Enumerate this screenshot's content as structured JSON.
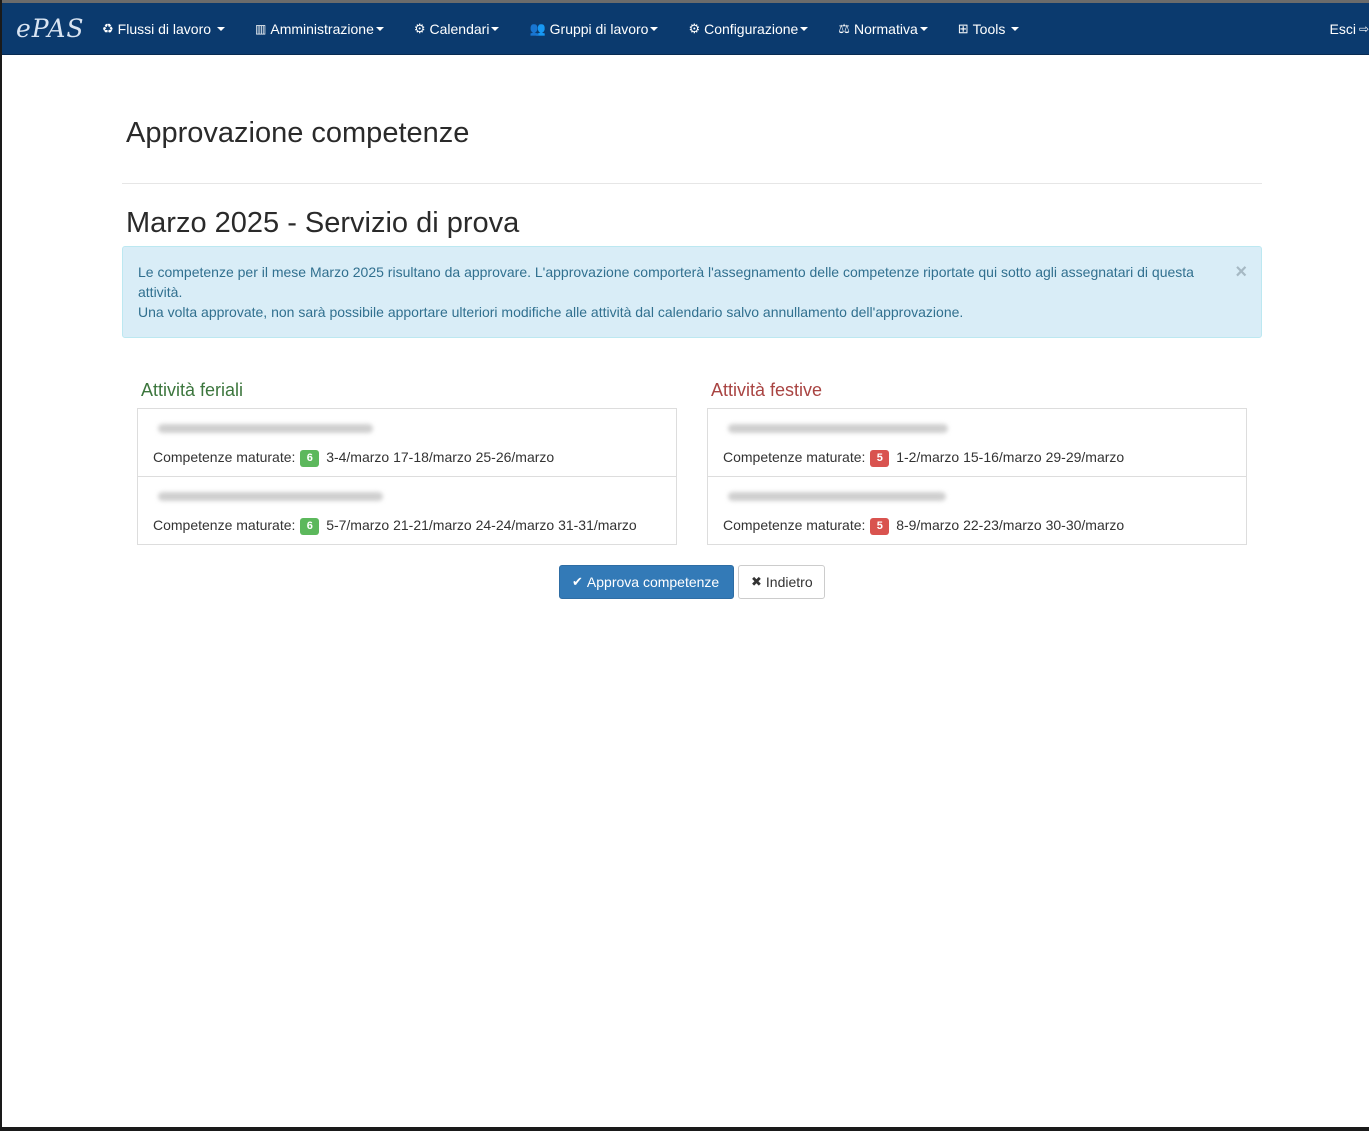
{
  "app": {
    "brand": "ePAS"
  },
  "nav": {
    "items": [
      {
        "label": "Flussi di lavoro",
        "icon": "recycle-icon",
        "glyph": "♻"
      },
      {
        "label": "Amministrazione",
        "icon": "bar-chart-icon",
        "glyph": "📊"
      },
      {
        "label": "Calendari",
        "icon": "gear-icon",
        "glyph": "⚙"
      },
      {
        "label": "Gruppi di lavoro",
        "icon": "users-icon",
        "glyph": "👥"
      },
      {
        "label": "Configurazione",
        "icon": "gear-icon",
        "glyph": "⚙"
      },
      {
        "label": "Normativa",
        "icon": "balance-scale-icon",
        "glyph": "⚖"
      },
      {
        "label": "Tools",
        "icon": "medkit-icon",
        "glyph": "🧰"
      }
    ],
    "logout": "Esci"
  },
  "page": {
    "title": "Approvazione competenze",
    "subtitle": "Marzo 2025 - Servizio di prova"
  },
  "alert": {
    "line1": "Le competenze per il mese Marzo 2025 risultano da approvare. L'approvazione comporterà l'assegnamento delle competenze riportate qui sotto agli assegnatari di questa attività.",
    "line2": "Una volta approvate, non sarà possibile apportare ulteriori modifiche alle attività dal calendario salvo annullamento dell'approvazione.",
    "close": "×"
  },
  "feriali": {
    "title": "Attività feriali",
    "items": [
      {
        "label": "Competenze maturate:",
        "count": "6",
        "days": "3-4/marzo 17-18/marzo 25-26/marzo"
      },
      {
        "label": "Competenze maturate:",
        "count": "6",
        "days": "5-7/marzo 21-21/marzo 24-24/marzo 31-31/marzo"
      }
    ]
  },
  "festive": {
    "title": "Attività festive",
    "items": [
      {
        "label": "Competenze maturate:",
        "count": "5",
        "days": "1-2/marzo 15-16/marzo 29-29/marzo"
      },
      {
        "label": "Competenze maturate:",
        "count": "5",
        "days": "8-9/marzo 22-23/marzo 30-30/marzo"
      }
    ]
  },
  "buttons": {
    "approve": "Approva competenze",
    "back": "Indietro"
  },
  "colors": {
    "navbar": "#0b3a6e",
    "primary": "#337ab7",
    "success": "#5cb85c",
    "danger": "#d9534f"
  }
}
